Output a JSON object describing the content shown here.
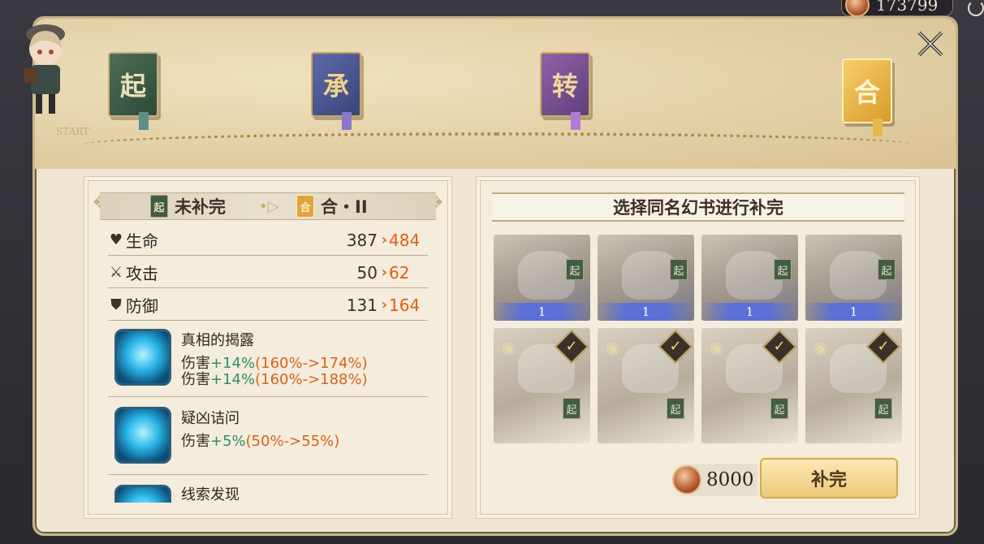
{
  "currency": {
    "icon": "coin-icon",
    "amount": "173799"
  },
  "chapters": [
    {
      "label": "起",
      "color": "#2e4a3a"
    },
    {
      "label": "承",
      "color": "#3c437a"
    },
    {
      "label": "转",
      "color": "#5f3f7c"
    },
    {
      "label": "合",
      "color": "#d99a28"
    }
  ],
  "map_labels": {
    "start": "START"
  },
  "transition": {
    "from_badge": "起",
    "from_label": "未补完",
    "to_badge": "合",
    "to_label": "合・II"
  },
  "stats": [
    {
      "icon": "heart-icon",
      "label": "生命",
      "old": "387",
      "new": "484"
    },
    {
      "icon": "sword-icon",
      "label": "攻击",
      "old": "50",
      "new": "62"
    },
    {
      "icon": "shield-icon",
      "label": "防御",
      "old": "131",
      "new": "164"
    }
  ],
  "skills": [
    {
      "name": "真相的揭露",
      "lines": [
        {
          "prefix": "伤害",
          "bonus": "+14%",
          "detail": "(160%->174%)"
        },
        {
          "prefix": "伤害",
          "bonus": "+14%",
          "detail": "(160%->188%)"
        }
      ]
    },
    {
      "name": "疑凶诘问",
      "lines": [
        {
          "prefix": "伤害",
          "bonus": "+5%",
          "detail": "(50%->55%)"
        }
      ]
    },
    {
      "name": "线索发现",
      "lines": []
    }
  ],
  "right_panel": {
    "title": "选择同名幻书进行补完",
    "top_cards": [
      {
        "tag": "起",
        "level": "1"
      },
      {
        "tag": "起",
        "level": "1"
      },
      {
        "tag": "起",
        "level": "1"
      },
      {
        "tag": "起",
        "level": "1"
      }
    ],
    "bottom_cards": [
      {
        "tag": "起"
      },
      {
        "tag": "起"
      },
      {
        "tag": "起"
      },
      {
        "tag": "起"
      }
    ],
    "cost": "8000",
    "confirm_label": "补完"
  },
  "colors": {
    "accent": "#df5f14",
    "bonus_green": "#2f8f6a",
    "gold": "#edc978"
  }
}
